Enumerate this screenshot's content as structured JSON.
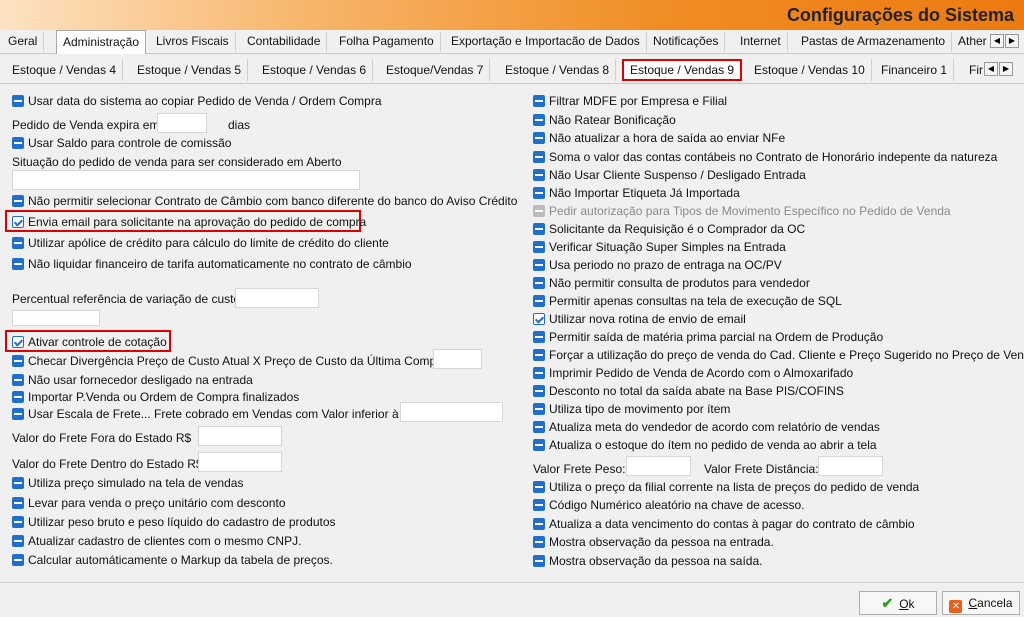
{
  "window": {
    "title": "Configurações do Sistema"
  },
  "tabs_row1": [
    "Geral",
    "Administração",
    "Livros Fiscais",
    "Contabilidade",
    "Folha Pagamento",
    "Exportação e Importacão de Dados",
    "Notificações",
    "Internet",
    "Pastas de Armazenamento",
    "Ather"
  ],
  "tabs_row2": [
    "Estoque / Vendas 4",
    "Estoque / Vendas 5",
    "Estoque / Vendas 6",
    "Estoque/Vendas 7",
    "Estoque / Vendas 8",
    "Estoque / Vendas 9",
    "Estoque / Vendas 10",
    "Financeiro 1",
    "Fir"
  ],
  "left": {
    "usar_data": "Usar data do sistema ao copiar Pedido de Venda / Ordem Compra",
    "pedido_expira": "Pedido de Venda expira em",
    "dias": "dias",
    "usar_saldo": "Usar Saldo para controle de comissão",
    "situacao": "Situação do pedido de venda para ser considerado em Aberto",
    "nao_permitir_contrato": "Não permitir selecionar Contrato de Câmbio com banco diferente do banco do Aviso Crédito",
    "envia_email": "Envia email para solicitante na aprovação do pedido de compra",
    "utilizar_apolice": "Utilizar apólice de crédito para cálculo do limite de crédito do cliente",
    "nao_liquidar": "Não liquidar financeiro de tarifa automaticamente no contrato de câmbio",
    "percentual": "Percentual referência de variação de custo",
    "ativar_cotacao": "Ativar controle de cotação",
    "checar_divergencia": "Checar Divergência Preço de Custo Atual X Preço de Custo da Última Compra:",
    "nao_usar_fornecedor": "Não usar fornecedor desligado na entrada",
    "importar_pvenda": "Importar P.Venda ou Ordem de Compra finalizados",
    "usar_escala": "Usar Escala de Frete... Frete cobrado em Vendas com Valor inferior à R$",
    "frete_fora": "Valor do Frete Fora do Estado R$",
    "frete_dentro": "Valor do Frete Dentro do Estado R$",
    "utiliza_preco_simulado": "Utiliza preço simulado na tela de vendas",
    "levar_preco_unitario": "Levar para venda o preço unitário com desconto",
    "utilizar_peso": "Utilizar peso bruto e peso líquido do cadastro de produtos",
    "atualizar_cadastro": "Atualizar cadastro de clientes com o mesmo CNPJ.",
    "calcular_markup": "Calcular automáticamente o Markup da tabela de preços."
  },
  "right": {
    "filtrar_mdfe": "Filtrar MDFE por Empresa e Filial",
    "nao_ratear": "Não Ratear Bonificação",
    "nao_atualizar_hora": "Não atualizar a hora de saída ao enviar NFe",
    "soma_contas": "Soma o valor das contas contábeis no Contrato de Honorário indepente da natureza",
    "nao_usar_cliente": "Não Usar Cliente Suspenso / Desligado Entrada",
    "nao_importar_etiqueta": "Não Importar Etiqueta Já Importada",
    "pedir_autorizacao": "Pedir autorização para Tipos de Movimento Específico no Pedido de Venda",
    "solicitante_requisicao": "Solicitante da Requisição é o Comprador da OC",
    "verificar_simples": "Verificar Situação Super Simples na Entrada",
    "usa_periodo": "Usa periodo no prazo de entraga na OC/PV",
    "nao_permitir_consulta": "Não permitir consulta de produtos para vendedor",
    "permitir_consultas_sql": "Permitir apenas consultas na tela de execução de SQL",
    "utilizar_rotina_email": "Utilizar nova rotina de envio de email",
    "permitir_saida_mp": "Permitir saída de matéria prima parcial na Ordem de Produção",
    "forcar_preco": "Forçar a utilização do preço de venda do Cad. Cliente e Preço Sugerido no Preço de Venda",
    "imprimir_pedido": "Imprimir Pedido de Venda de Acordo com o Almoxarifado",
    "desconto_pis": "Desconto no total da saída abate na Base PIS/COFINS",
    "utiliza_tipo_mov": "Utiliza tipo de movimento por ítem",
    "atualiza_meta": "Atualiza meta do vendedor de acordo com relatório de vendas",
    "atualiza_estoque": "Atualiza o estoque do ítem no pedido de venda ao abrir a tela",
    "valor_frete_peso": "Valor Frete Peso:",
    "valor_frete_distancia": "Valor Frete Distância:",
    "utiliza_preco_filial": "Utiliza o preço da filial corrente na lista de preços do pedido de venda",
    "codigo_numerico": "Código Numérico aleatório na chave de acesso.",
    "atualiza_vencimento": "Atualiza a data vencimento do contas à pagar do contrato de câmbio",
    "mostra_obs_entrada": "Mostra observação da pessoa na entrada.",
    "mostra_obs_saida": "Mostra observação da pessoa na saída."
  },
  "buttons": {
    "ok_label": "Ok",
    "ok_prefix": "",
    "ok_u": "O",
    "ok_rest": "k",
    "cancel_u": "C",
    "cancel_rest": "ancela"
  },
  "colors": {
    "accent": "#1f6fd1",
    "highlight": "#e00000",
    "title_gradient_end": "#ec7a10"
  }
}
